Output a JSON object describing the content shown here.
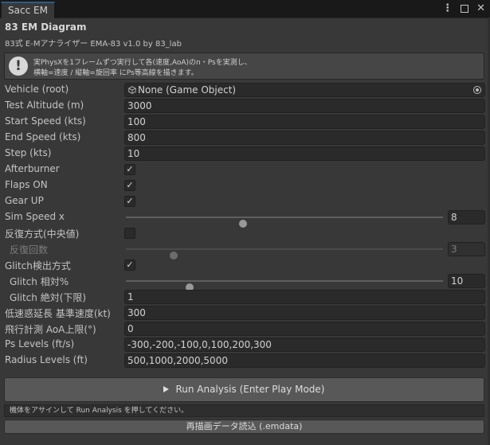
{
  "window": {
    "tab_label": "Sacc EM",
    "title": "83 EM Diagram",
    "subtitle": "83式 E-Mアナライザー EMA-83  v1.0   by 83_lab",
    "help": {
      "line1": "実PhysXを1フレームずつ実行して各(速度,AoA)のn・Psを実測し、",
      "line2": "横軸=速度 / 縦軸=旋回率 にPs等高線を描きます。"
    }
  },
  "fields": {
    "vehicle": {
      "label": "Vehicle (root)",
      "value": "None (Game Object)"
    },
    "test_altitude": {
      "label": "Test Altitude (m)",
      "value": "3000"
    },
    "start_speed": {
      "label": "Start Speed (kts)",
      "value": "100"
    },
    "end_speed": {
      "label": "End Speed (kts)",
      "value": "800"
    },
    "step": {
      "label": "Step (kts)",
      "value": "10"
    },
    "afterburner": {
      "label": "Afterburner",
      "checked": true
    },
    "flaps_on": {
      "label": "Flaps ON",
      "checked": true
    },
    "gear_up": {
      "label": "Gear UP",
      "checked": true
    },
    "sim_speed": {
      "label": "Sim Speed x",
      "value": "8",
      "fraction": 0.37
    },
    "repeat_mode": {
      "label": "反復方式(中央値)",
      "checked": false
    },
    "repeat_count": {
      "label": "反復回数",
      "value": "3",
      "fraction": 0.15
    },
    "glitch_detect": {
      "label": "Glitch検出方式",
      "checked": true
    },
    "glitch_relative": {
      "label": "Glitch 相対%",
      "value": "10",
      "fraction": 0.2
    },
    "glitch_absolute": {
      "label": "Glitch 絶対(下限)",
      "value": "1"
    },
    "low_speed_base": {
      "label": "低速惑延長 基準速度(kt)",
      "value": "300"
    },
    "flight_aoa_limit": {
      "label": "飛行計測 AoA上限(°)",
      "value": "0"
    },
    "ps_levels": {
      "label": "Ps Levels (ft/s)",
      "value": "-300,-200,-100,0,100,200,300"
    },
    "radius_levels": {
      "label": "Radius Levels (ft)",
      "value": "500,1000,2000,5000"
    }
  },
  "buttons": {
    "run_analysis": "Run Analysis  (Enter Play Mode)",
    "load_data": "再描画データ読込 (.emdata)"
  },
  "status": "機体をアサインして Run Analysis を押してください。",
  "icons": {
    "menu": "kebab-menu-icon",
    "maximize": "maximize-icon",
    "close": "close-icon",
    "warning": "info-exclamation-icon",
    "object": "gameobject-cube-icon",
    "picker": "object-picker-icon",
    "play": "play-icon"
  }
}
